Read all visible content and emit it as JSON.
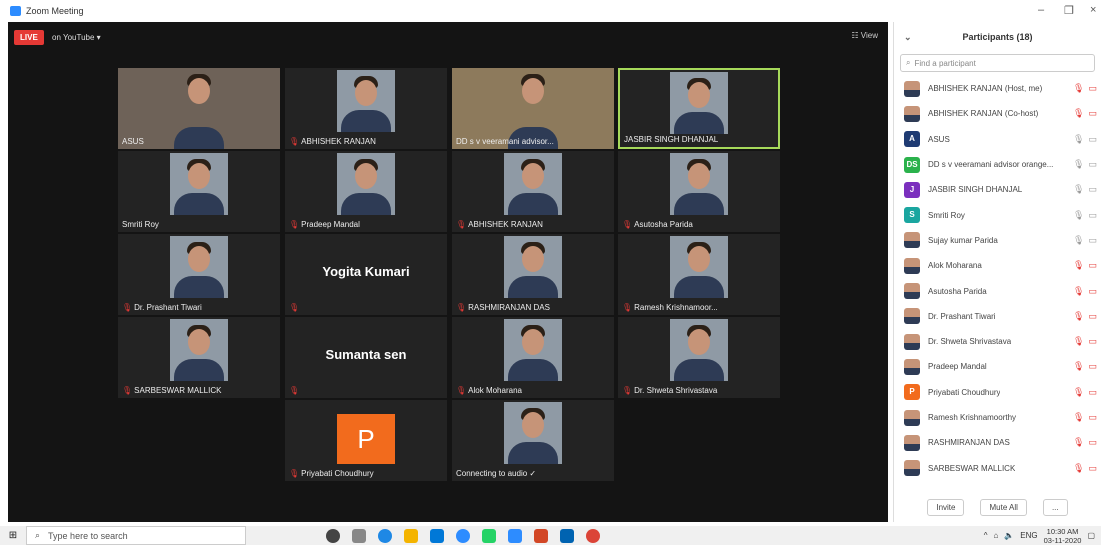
{
  "window": {
    "title": "Zoom Meeting"
  },
  "meeting": {
    "live_label": "LIVE",
    "stream_label": "on YouTube ▾",
    "view_label": "☷ View"
  },
  "tiles": [
    {
      "name": "ASUS",
      "muted": false
    },
    {
      "name": "ABHISHEK RANJAN",
      "muted": true
    },
    {
      "name": "DD s v veeramani advisor...",
      "muted": false
    },
    {
      "name": "JASBIR SINGH DHANJAL",
      "muted": false
    },
    {
      "name": "Smriti Roy",
      "muted": false
    },
    {
      "name": "Pradeep Mandal",
      "muted": true
    },
    {
      "name": "ABHISHEK RANJAN",
      "muted": true
    },
    {
      "name": "Asutosha Parida",
      "muted": true
    },
    {
      "name": "Dr. Prashant Tiwari",
      "muted": true
    },
    {
      "name": "",
      "big": "Yogita Kumari",
      "muted": true
    },
    {
      "name": "RASHMIRANJAN DAS",
      "muted": true
    },
    {
      "name": "Ramesh Krishnamoor...",
      "muted": true
    },
    {
      "name": "SARBESWAR MALLICK",
      "muted": true
    },
    {
      "name": "",
      "big": "Sumanta sen",
      "muted": true
    },
    {
      "name": "Alok Moharana",
      "muted": true
    },
    {
      "name": "Dr. Shweta Shrivastava",
      "muted": true
    },
    {
      "name": "Priyabati Choudhury",
      "muted": true,
      "letter": "P"
    },
    {
      "name": "Connecting to audio ✓",
      "muted": false
    }
  ],
  "panel": {
    "title": "Participants (18)",
    "search_placeholder": "Find a participant",
    "participants": [
      {
        "name": "ABHISHEK RANJAN (Host, me)",
        "avatar": "",
        "color": "",
        "muted": true
      },
      {
        "name": "ABHISHEK RANJAN (Co-host)",
        "avatar": "",
        "color": "",
        "muted": true
      },
      {
        "name": "ASUS",
        "avatar": "A",
        "color": "#1f3b73",
        "muted": false
      },
      {
        "name": "DD s v veeramani advisor orange...",
        "avatar": "DS",
        "color": "#2bb24c",
        "muted": false
      },
      {
        "name": "JASBIR SINGH DHANJAL",
        "avatar": "J",
        "color": "#7b2fbe",
        "muted": false
      },
      {
        "name": "Smriti Roy",
        "avatar": "S",
        "color": "#1aa6a0",
        "muted": false
      },
      {
        "name": "Sujay kumar Parida",
        "avatar": "",
        "color": "",
        "muted": false
      },
      {
        "name": "Alok Moharana",
        "avatar": "",
        "color": "",
        "muted": true
      },
      {
        "name": "Asutosha Parida",
        "avatar": "",
        "color": "",
        "muted": true
      },
      {
        "name": "Dr. Prashant Tiwari",
        "avatar": "",
        "color": "",
        "muted": true
      },
      {
        "name": "Dr. Shweta Shrivastava",
        "avatar": "",
        "color": "",
        "muted": true
      },
      {
        "name": "Pradeep Mandal",
        "avatar": "",
        "color": "",
        "muted": true
      },
      {
        "name": "Priyabati Choudhury",
        "avatar": "P",
        "color": "#f26b1d",
        "muted": true
      },
      {
        "name": "Ramesh Krishnamoorthy",
        "avatar": "",
        "color": "",
        "muted": true
      },
      {
        "name": "RASHMIRANJAN DAS",
        "avatar": "",
        "color": "",
        "muted": true
      },
      {
        "name": "SARBESWAR MALLICK",
        "avatar": "",
        "color": "",
        "muted": true
      }
    ],
    "invite_label": "Invite",
    "mute_all_label": "Mute All",
    "more_label": "..."
  },
  "taskbar": {
    "search_placeholder": "Type here to search",
    "lang": "ENG",
    "time": "10:30 AM",
    "date": "03-11-2020"
  }
}
